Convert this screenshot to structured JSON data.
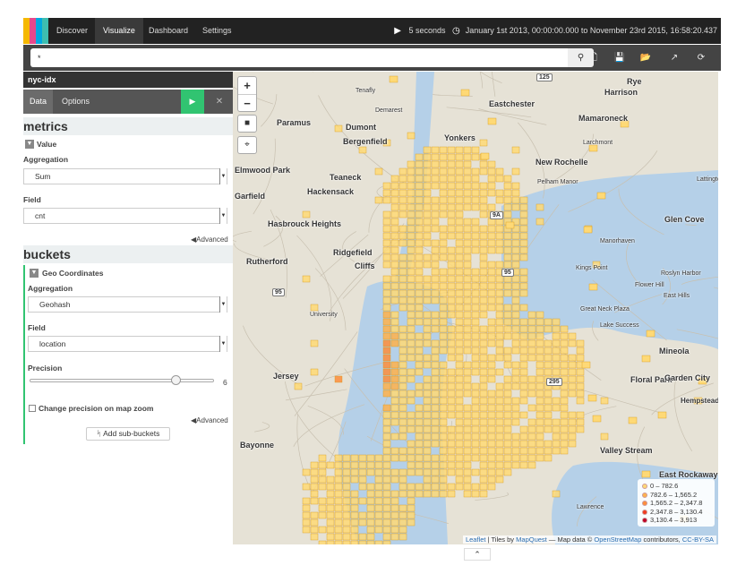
{
  "nav": {
    "tabs": [
      "Discover",
      "Visualize",
      "Dashboard",
      "Settings"
    ],
    "active_tab": "Visualize",
    "refresh_interval": "5 seconds",
    "time_range": "January 1st 2013, 00:00:00.000 to November 23rd 2015, 16:58:20.437",
    "logo_colors": [
      "#f5b800",
      "#e8478b",
      "#00a9e0",
      "#3ebeb0"
    ]
  },
  "search": {
    "query": "*"
  },
  "sidebar": {
    "index_name": "nyc-idx",
    "tabs": [
      "Data",
      "Options"
    ],
    "metrics": {
      "heading": "metrics",
      "item_label": "Value",
      "aggregation_label": "Aggregation",
      "aggregation_value": "Sum",
      "field_label": "Field",
      "field_value": "cnt",
      "advanced": "Advanced"
    },
    "buckets": {
      "heading": "buckets",
      "item_label": "Geo Coordinates",
      "aggregation_label": "Aggregation",
      "aggregation_value": "Geohash",
      "field_label": "Field",
      "field_value": "location",
      "precision_label": "Precision",
      "precision_value": "6",
      "checkbox_label": "Change precision on map zoom",
      "advanced": "Advanced",
      "add_button": "Add sub-buckets"
    }
  },
  "map": {
    "places": [
      {
        "name": "Harrison",
        "size": 9
      },
      {
        "name": "Rye",
        "size": 9
      },
      {
        "name": "Eastchester",
        "size": 9
      },
      {
        "name": "Mamaroneck",
        "size": 9
      },
      {
        "name": "Paramus",
        "size": 9
      },
      {
        "name": "Dumont",
        "size": 9
      },
      {
        "name": "Bergenfield",
        "size": 9
      },
      {
        "name": "Yonkers",
        "size": 9
      },
      {
        "name": "New Rochelle",
        "size": 9
      },
      {
        "name": "Elmwood Park",
        "size": 9
      },
      {
        "name": "Teaneck",
        "size": 9
      },
      {
        "name": "Hackensack",
        "size": 9
      },
      {
        "name": "Garfield",
        "size": 9
      },
      {
        "name": "Hasbrouck Heights",
        "size": 9
      },
      {
        "name": "Glen Cove",
        "size": 9
      },
      {
        "name": "Ridgefield",
        "size": 9
      },
      {
        "name": "Rutherford",
        "size": 9
      },
      {
        "name": "Cliffs",
        "size": 9
      },
      {
        "name": "Mineola",
        "size": 9
      },
      {
        "name": "Floral Park",
        "size": 9
      },
      {
        "name": "Garden City",
        "size": 9
      },
      {
        "name": "Jersey",
        "size": 9
      },
      {
        "name": "Hempstead",
        "size": 8
      },
      {
        "name": "Bayonne",
        "size": 9
      },
      {
        "name": "Valley Stream",
        "size": 9
      },
      {
        "name": "East Rockaway",
        "size": 9
      },
      {
        "name": "Pelham Manor",
        "size": 7
      },
      {
        "name": "Larchmont",
        "size": 7
      },
      {
        "name": "Manorhaven",
        "size": 7
      },
      {
        "name": "Kings Point",
        "size": 7
      },
      {
        "name": "Roslyn Harbor",
        "size": 7
      },
      {
        "name": "Flower Hill",
        "size": 7
      },
      {
        "name": "East Hills",
        "size": 7
      },
      {
        "name": "Great Neck Plaza",
        "size": 7
      },
      {
        "name": "Lake Success",
        "size": 7
      },
      {
        "name": "Lattingtown",
        "size": 7
      },
      {
        "name": "Demarest",
        "size": 7
      },
      {
        "name": "Lawrence",
        "size": 7
      },
      {
        "name": "Tenafly",
        "size": 7
      },
      {
        "name": "University",
        "size": 7
      }
    ],
    "legend": [
      {
        "label": "0 – 782.6",
        "color": "#fed976"
      },
      {
        "label": "782.6 – 1,565.2",
        "color": "#feb24c"
      },
      {
        "label": "1,565.2 – 2,347.8",
        "color": "#fd8d3c"
      },
      {
        "label": "2,347.8 – 3,130.4",
        "color": "#f03b20"
      },
      {
        "label": "3,130.4 – 3,913",
        "color": "#bd0026"
      }
    ],
    "attribution": {
      "leaflet": "Leaflet",
      "tiles_prefix": "| Tiles by",
      "mapquest": "MapQuest",
      "data_prefix": "— Map data ©",
      "osm": "OpenStreetMap",
      "contrib": "contributors,",
      "license": "CC-BY-SA"
    },
    "highway_shields": [
      "125",
      "95",
      "95",
      "295",
      "9A"
    ]
  }
}
